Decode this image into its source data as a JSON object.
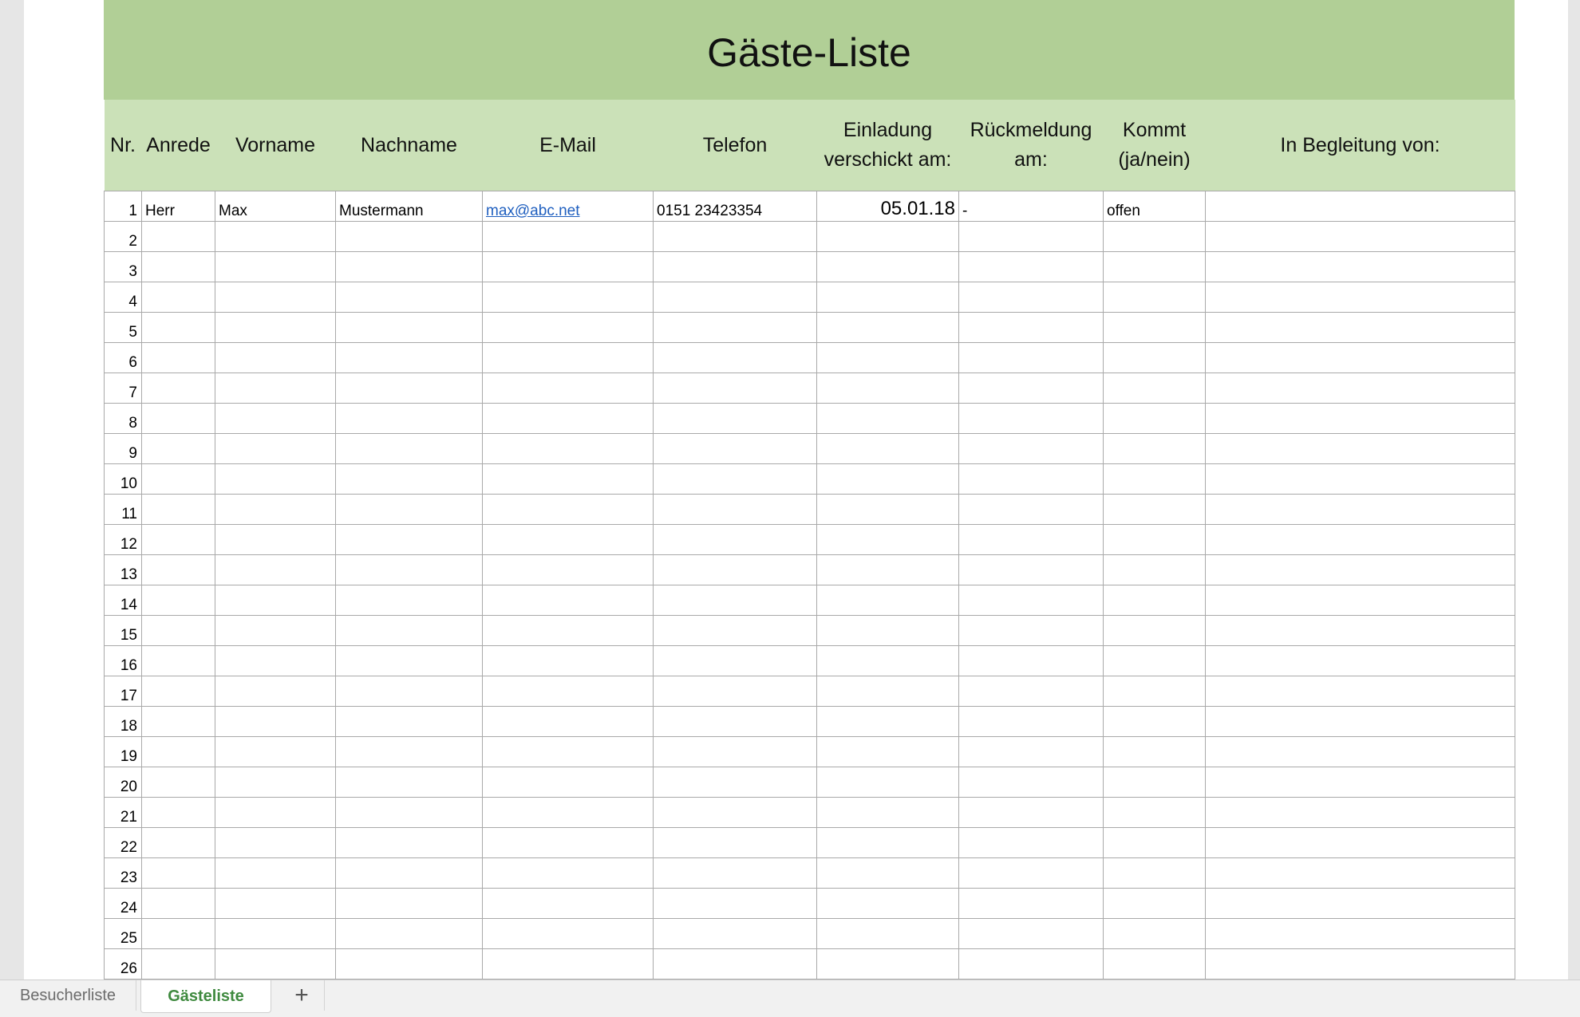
{
  "sheet": {
    "title": "Gäste-Liste",
    "headers": {
      "nr": "Nr.",
      "anrede": "Anrede",
      "vorname": "Vorname",
      "nachname": "Nachname",
      "email": "E-Mail",
      "telefon": "Telefon",
      "einladung_line1": "Einladung",
      "einladung_line2": "verschickt am:",
      "rueckmeldung_line1": "Rückmeldung",
      "rueckmeldung_line2": "am:",
      "kommt_line1": "Kommt",
      "kommt_line2": "(ja/nein)",
      "begleitung": "In Begleitung von:"
    },
    "rows": [
      {
        "nr": "1",
        "anrede": "Herr",
        "vorname": "Max",
        "nachname": "Mustermann",
        "email": "max@abc.net",
        "telefon": "0151 23423354",
        "einladung": "05.01.18",
        "rueckmeldung": "-",
        "kommt": "offen",
        "begleitung": ""
      },
      {
        "nr": "2"
      },
      {
        "nr": "3"
      },
      {
        "nr": "4"
      },
      {
        "nr": "5"
      },
      {
        "nr": "6"
      },
      {
        "nr": "7"
      },
      {
        "nr": "8"
      },
      {
        "nr": "9"
      },
      {
        "nr": "10"
      },
      {
        "nr": "11"
      },
      {
        "nr": "12"
      },
      {
        "nr": "13"
      },
      {
        "nr": "14"
      },
      {
        "nr": "15"
      },
      {
        "nr": "16"
      },
      {
        "nr": "17"
      },
      {
        "nr": "18"
      },
      {
        "nr": "19"
      },
      {
        "nr": "20"
      },
      {
        "nr": "21"
      },
      {
        "nr": "22"
      },
      {
        "nr": "23"
      },
      {
        "nr": "24"
      },
      {
        "nr": "25"
      },
      {
        "nr": "26"
      }
    ]
  },
  "tabs": {
    "items": [
      {
        "label": "Besucherliste",
        "active": false
      },
      {
        "label": "Gästeliste",
        "active": true
      }
    ],
    "add_label": "+"
  },
  "colors": {
    "title_band": "#b1cf96",
    "header_band": "#cbe1b8",
    "active_tab_text": "#3f8a3f",
    "link": "#1f5fbf"
  }
}
